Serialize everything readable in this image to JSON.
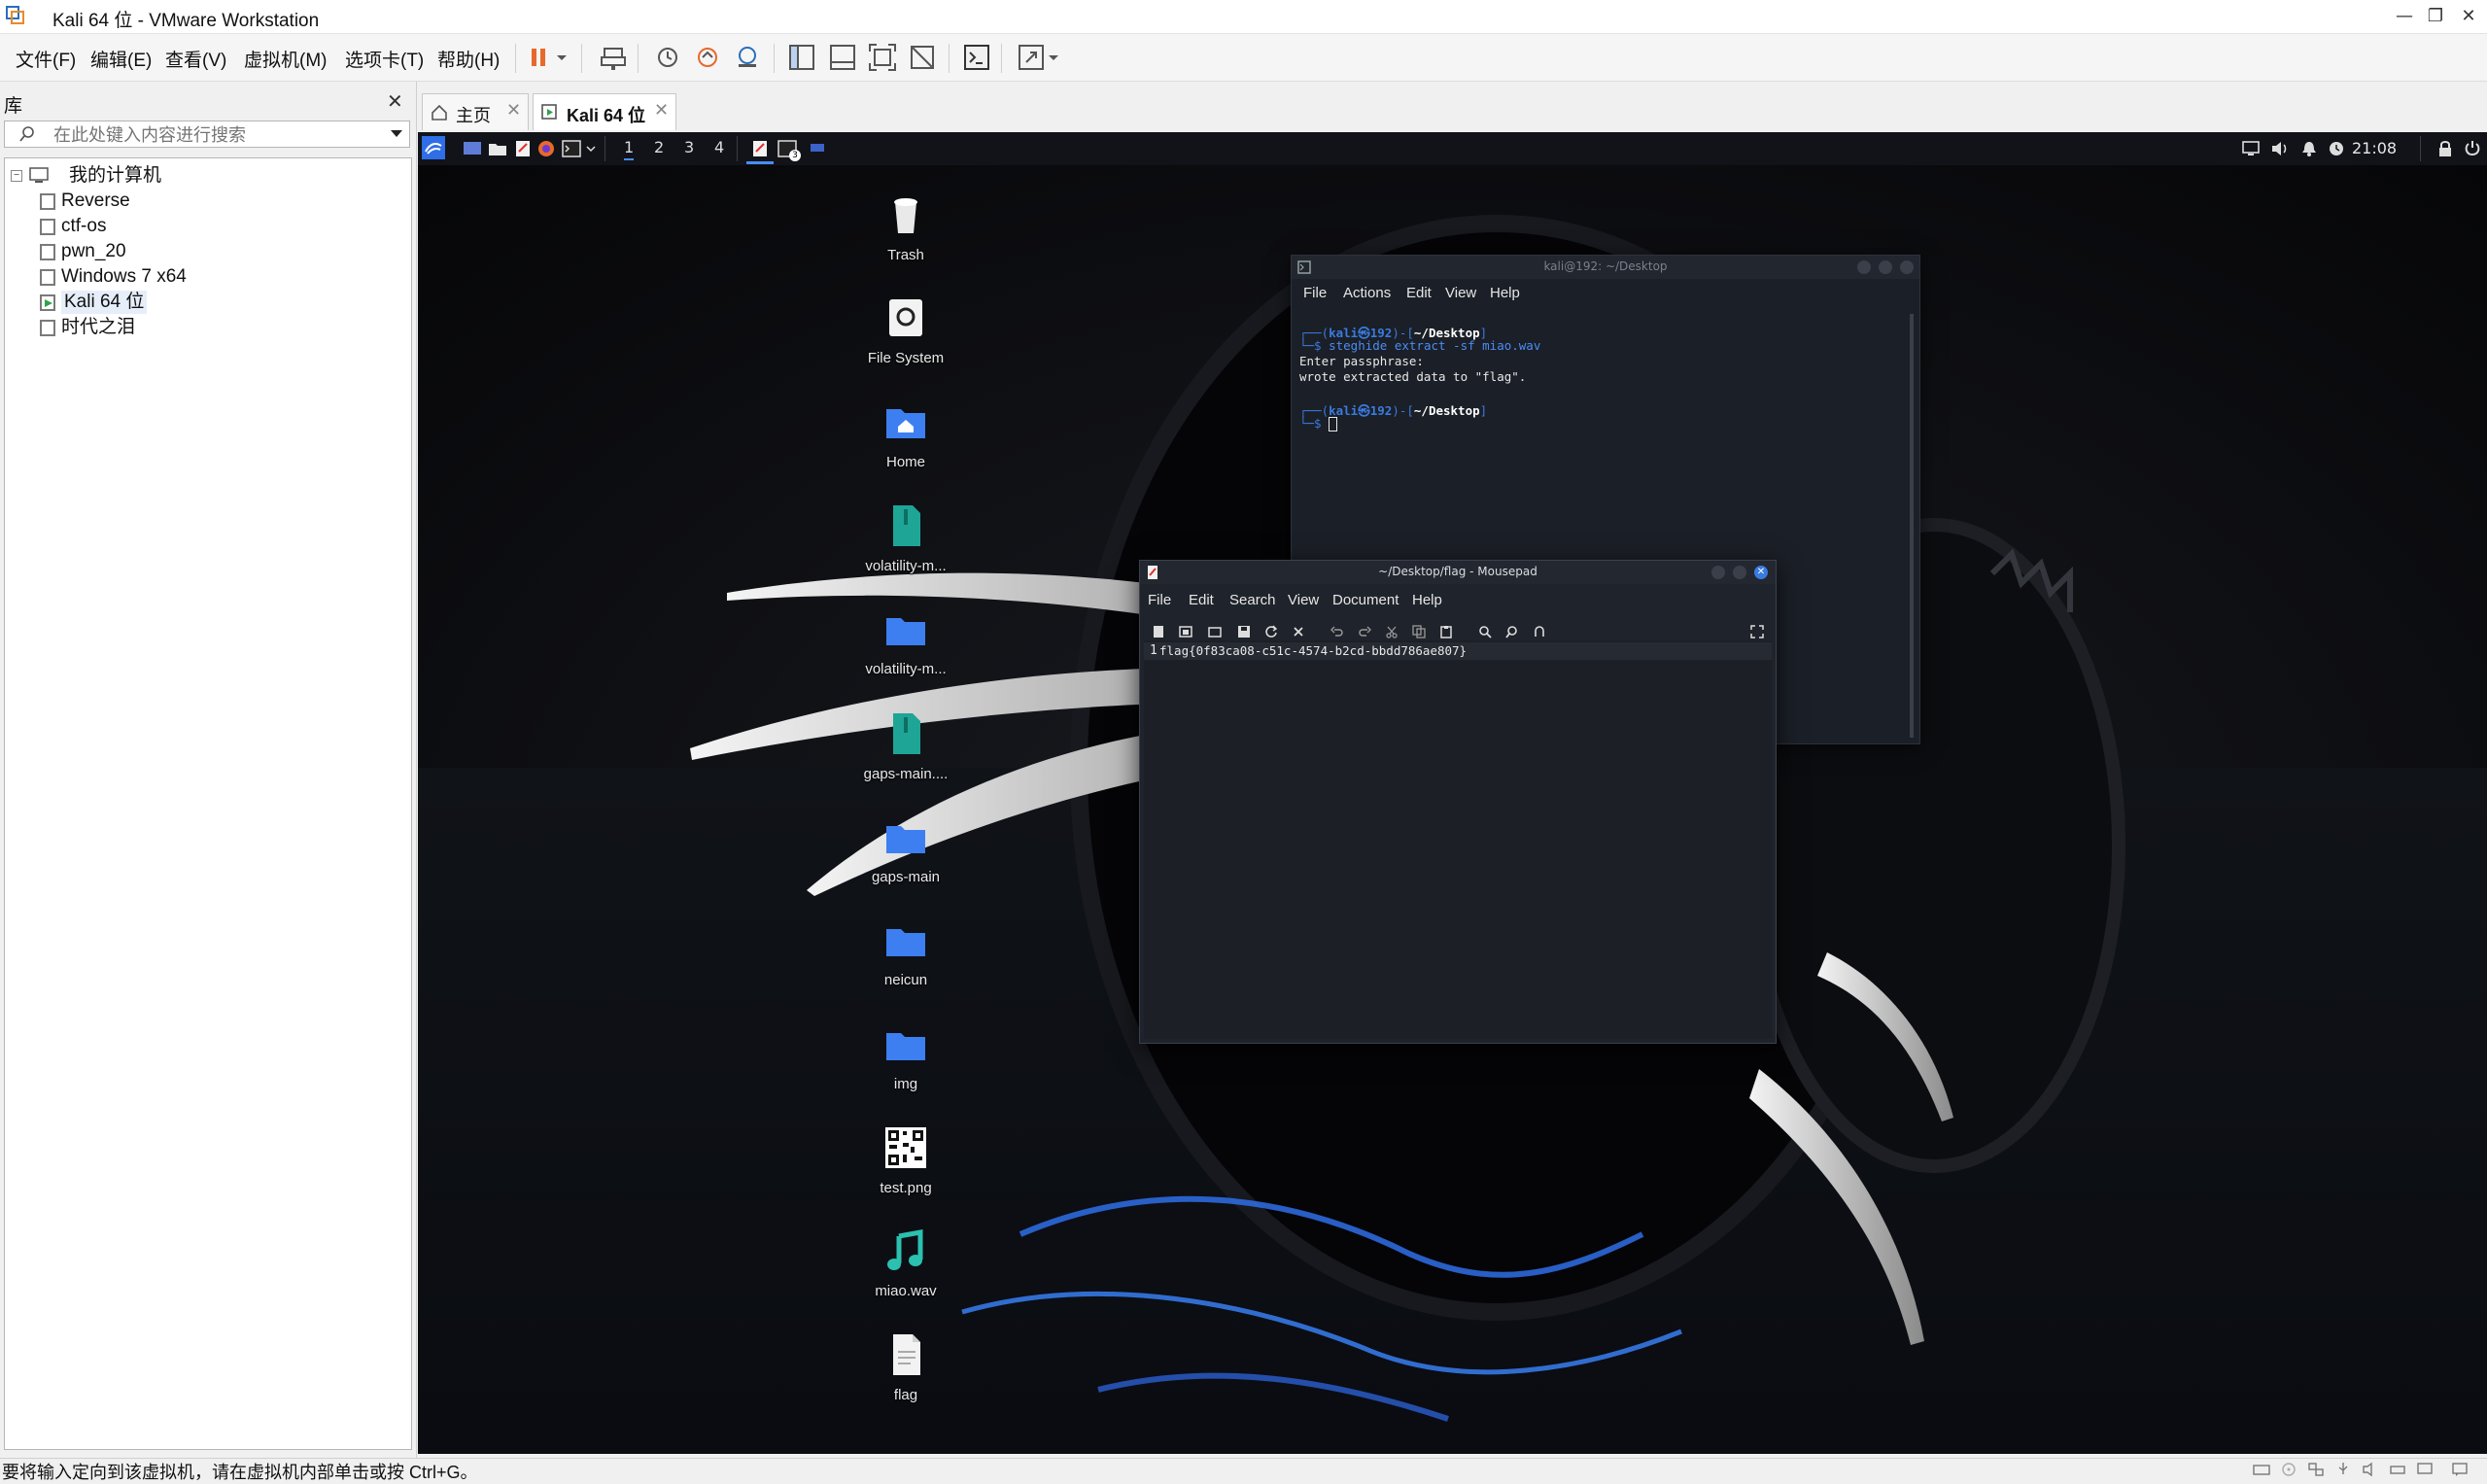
{
  "window": {
    "title": "Kali 64 位 - VMware Workstation"
  },
  "menu": [
    "文件(F)",
    "编辑(E)",
    "查看(V)",
    "虚拟机(M)",
    "选项卡(T)",
    "帮助(H)"
  ],
  "library": {
    "title": "库",
    "search_placeholder": "在此处键入内容进行搜索",
    "root": "我的计算机",
    "vms": [
      "Reverse",
      "ctf-os",
      "pwn_20",
      "Windows 7 x64",
      "Kali 64 位",
      "时代之泪"
    ]
  },
  "tabs": [
    {
      "label": "主页"
    },
    {
      "label": "Kali 64 位"
    }
  ],
  "kali_panel": {
    "workspaces": [
      "1",
      "2",
      "3",
      "4"
    ],
    "clock": "21:08",
    "badge": "3"
  },
  "desktop_icons": [
    {
      "label": "Trash",
      "icon": "trash-icon"
    },
    {
      "label": "File System",
      "icon": "drive-icon"
    },
    {
      "label": "Home",
      "icon": "home-folder-icon"
    },
    {
      "label": "volatility-m...",
      "icon": "zip-icon"
    },
    {
      "label": "volatility-m...",
      "icon": "folder-icon"
    },
    {
      "label": "gaps-main....",
      "icon": "zip-icon"
    },
    {
      "label": "gaps-main",
      "icon": "folder-icon"
    },
    {
      "label": "neicun",
      "icon": "folder-icon"
    },
    {
      "label": "img",
      "icon": "folder-icon"
    },
    {
      "label": "test.png",
      "icon": "qr-image-icon"
    },
    {
      "label": "miao.wav",
      "icon": "audio-icon"
    },
    {
      "label": "flag",
      "icon": "text-file-icon"
    }
  ],
  "terminal": {
    "title": "kali@192: ~/Desktop",
    "menu": [
      "File",
      "Actions",
      "Edit",
      "View",
      "Help"
    ],
    "prompt_user": "kali",
    "prompt_host": "192",
    "prompt_dir": "~/Desktop",
    "command": "steghide extract -sf miao.wav",
    "output": [
      "Enter passphrase:",
      "wrote extracted data to \"flag\"."
    ]
  },
  "mousepad": {
    "title": "~/Desktop/flag - Mousepad",
    "menu": [
      "File",
      "Edit",
      "Search",
      "View",
      "Document",
      "Help"
    ],
    "line_number": "1",
    "content": "flag{0f83ca08-c51c-4574-b2cd-bbdd786ae807}"
  },
  "status": {
    "text": "要将输入定向到该虚拟机，请在虚拟机内部单击或按 Ctrl+G。"
  },
  "colors": {
    "accent": "#3a7be0",
    "kali_blue": "#4a8cf5",
    "orange": "#e8692c"
  }
}
